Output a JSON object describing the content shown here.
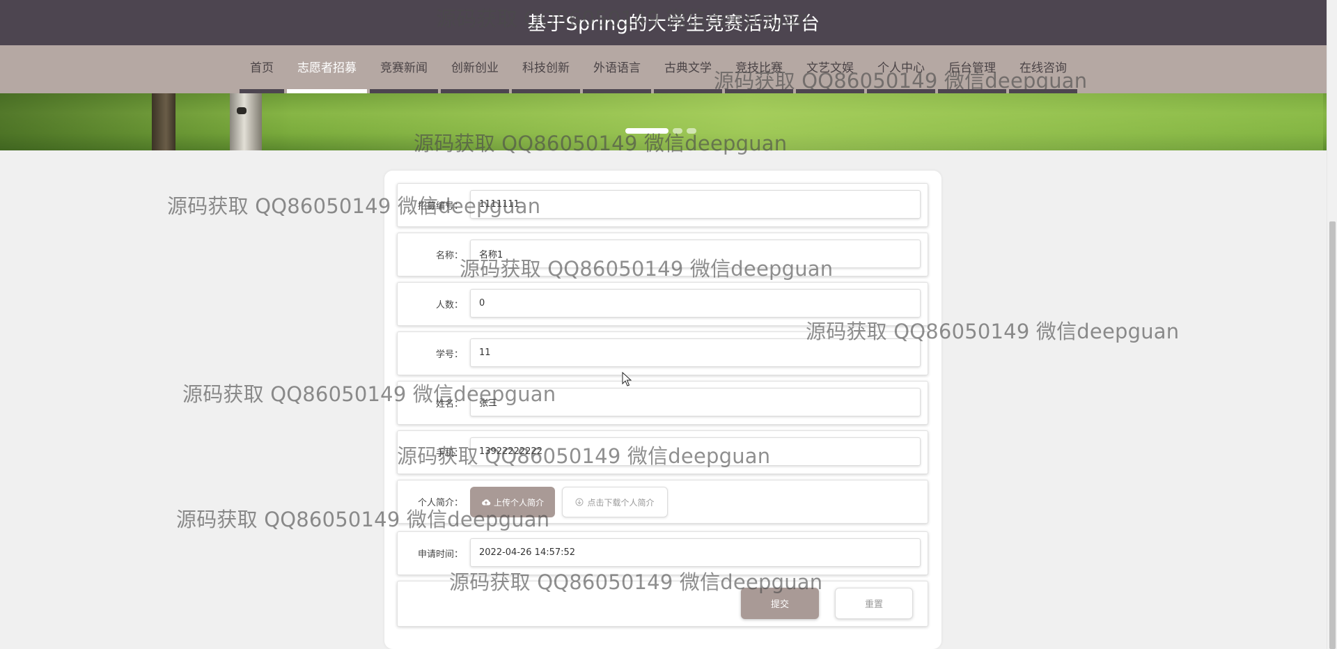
{
  "site": {
    "title": "基于Spring的大学生竞赛活动平台"
  },
  "nav": {
    "items": [
      "首页",
      "志愿者招募",
      "竞赛新闻",
      "创新创业",
      "科技创新",
      "外语语言",
      "古典文学",
      "竞技比赛",
      "文艺文娱",
      "个人中心",
      "后台管理",
      "在线咨询"
    ],
    "active_index": 1
  },
  "carousel": {
    "slide_count": 3,
    "active_index": 0
  },
  "form": {
    "fields": [
      {
        "label": "招募编号：",
        "value": "1111111"
      },
      {
        "label": "名称：",
        "value": "名称1"
      },
      {
        "label": "人数：",
        "value": "0"
      },
      {
        "label": "学号：",
        "value": "11"
      },
      {
        "label": "姓名：",
        "value": "张三"
      },
      {
        "label": "手机：",
        "value": "13922222222"
      }
    ],
    "resume": {
      "label": "个人简介：",
      "upload_label": "上传个人简介",
      "download_label": "点击下载个人简介"
    },
    "apply_time": {
      "label": "申请时间：",
      "value": "2022-04-26 14:57:52"
    },
    "submit_label": "提交",
    "reset_label": "重置"
  },
  "watermark": {
    "text": "源码获取 QQ86050149 微信deepguan"
  },
  "colors": {
    "header_bg": "#4d4550",
    "nav_bg": "#b5a8a3",
    "accent": "#a99a96",
    "page_bg": "#f0f0f0"
  }
}
